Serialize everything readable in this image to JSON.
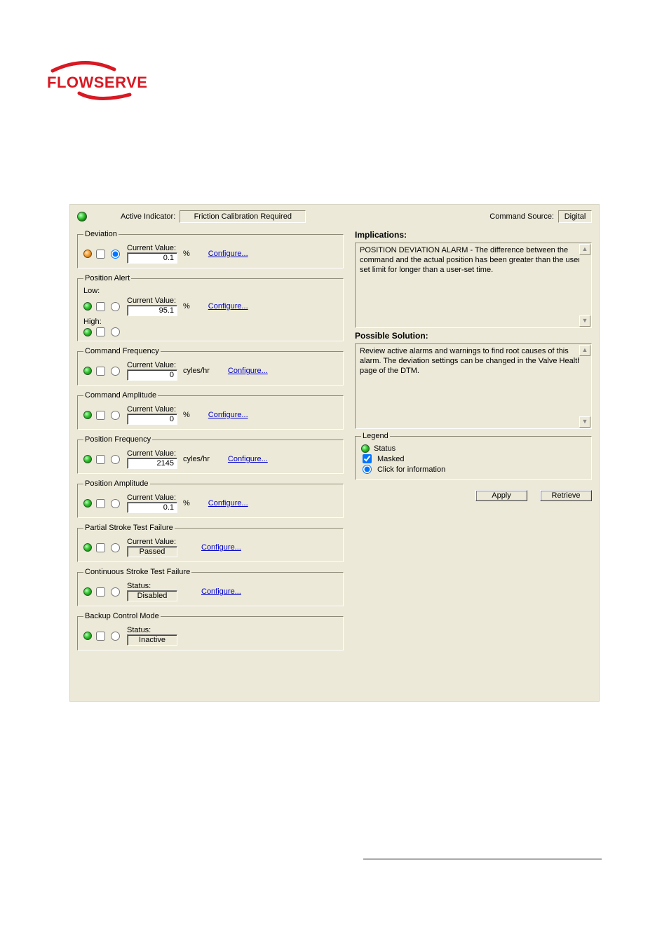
{
  "header": {
    "active_indicator_label": "Active Indicator:",
    "active_indicator_value": "Friction Calibration Required",
    "command_source_label": "Command Source:",
    "command_source_value": "Digital"
  },
  "groups": {
    "deviation": {
      "title": "Deviation",
      "current_value_label": "Current Value:",
      "value": "0.1",
      "unit": "%",
      "configure": "Configure...",
      "radio_selected": true
    },
    "position_alert": {
      "title": "Position Alert",
      "low_label": "Low:",
      "high_label": "High:",
      "current_value_label": "Current Value:",
      "value": "95.1",
      "unit": "%",
      "configure": "Configure..."
    },
    "command_frequency": {
      "title": "Command Frequency",
      "current_value_label": "Current Value:",
      "value": "0",
      "unit": "cyles/hr",
      "configure": "Configure..."
    },
    "command_amplitude": {
      "title": "Command Amplitude",
      "current_value_label": "Current Value:",
      "value": "0",
      "unit": "%",
      "configure": "Configure..."
    },
    "position_frequency": {
      "title": "Position Frequency",
      "current_value_label": "Current Value:",
      "value": "2145",
      "unit": "cyles/hr",
      "configure": "Configure..."
    },
    "position_amplitude": {
      "title": "Position Amplitude",
      "current_value_label": "Current Value:",
      "value": "0.1",
      "unit": "%",
      "configure": "Configure..."
    },
    "pst_failure": {
      "title": "Partial Stroke Test Failure",
      "current_value_label": "Current Value:",
      "value": "Passed",
      "configure": "Configure..."
    },
    "cst_failure": {
      "title": "Continuous Stroke Test Failure",
      "status_label": "Status:",
      "value": "Disabled",
      "configure": "Configure..."
    },
    "backup": {
      "title": "Backup Control Mode",
      "status_label": "Status:",
      "value": "Inactive"
    }
  },
  "implications": {
    "heading": "Implications:",
    "text": "POSITION DEVIATION ALARM - The difference between the command and the actual position has been greater than the user-set limit for longer than a user-set time."
  },
  "solution": {
    "heading": "Possible Solution:",
    "text": "Review active alarms and warnings to find root causes of this alarm.  The deviation settings can be changed in the Valve Health page of the DTM."
  },
  "legend": {
    "title": "Legend",
    "status": "Status",
    "masked": "Masked",
    "info": "Click for information"
  },
  "buttons": {
    "apply": "Apply",
    "retrieve": "Retrieve"
  }
}
